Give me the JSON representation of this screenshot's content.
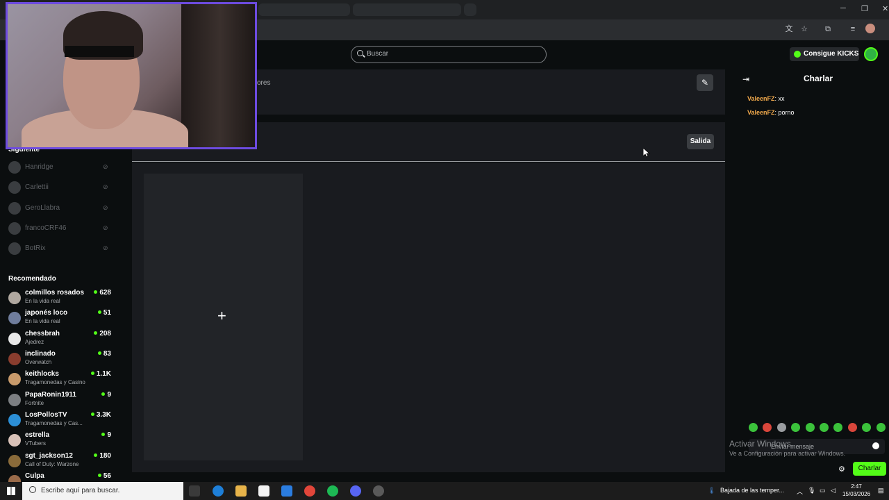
{
  "header": {
    "search_placeholder": "Buscar",
    "kicks_button": "Consigue KICKS"
  },
  "sidebar": {
    "following_heading": "Siguiente",
    "following": [
      {
        "name": "Hanridge"
      },
      {
        "name": "Carlettii"
      },
      {
        "name": "GeroLlabra"
      },
      {
        "name": "francoCRF46"
      },
      {
        "name": "BotRix"
      }
    ],
    "recommended_heading": "Recomendado",
    "recommended": [
      {
        "name": "colmillos rosados",
        "category": "En la vida real",
        "viewers": "628",
        "color": "#b0a8a0"
      },
      {
        "name": "japonés loco",
        "category": "En la vida real",
        "viewers": "51",
        "color": "#6f7d9c"
      },
      {
        "name": "chessbrah",
        "category": "Ajedrez",
        "viewers": "208",
        "color": "#e8e8e8"
      },
      {
        "name": "inclinado",
        "category": "Overwatch",
        "viewers": "83",
        "color": "#8a3d2e"
      },
      {
        "name": "keithlocks",
        "category": "Tragamonedas y Casino",
        "viewers": "1.1K",
        "color": "#c89a6b"
      },
      {
        "name": "PapaRonin1911",
        "category": "Fortnite",
        "viewers": "9",
        "color": "#7c7f82"
      },
      {
        "name": "LosPollosTV",
        "category": "Tragamonedas y Cas...",
        "viewers": "3.3K",
        "color": "#2c8fd6"
      },
      {
        "name": "estrella",
        "category": "VTubers",
        "viewers": "9",
        "color": "#d9c2b8"
      },
      {
        "name": "sgt_jackson12",
        "category": "Call of Duty: Warzone",
        "viewers": "180",
        "color": "#8a6b3a"
      },
      {
        "name": "Culpa",
        "category": "",
        "viewers": "56",
        "color": "#9a6b4a"
      }
    ]
  },
  "main": {
    "panel_partial_text": "ores",
    "edit_icon": "pencil-icon",
    "exit_button": "Salida"
  },
  "chat": {
    "title": "Charlar",
    "messages": [
      {
        "user": "ValeenFZ",
        "text": "xx"
      },
      {
        "user": "ValeenFZ",
        "text": "porno"
      }
    ],
    "input_placeholder": "Enviar mensaje",
    "send_button": "Charlar",
    "activation_title": "Activar Windows",
    "activation_subtitle": "Ve a Configuración para activar Windows."
  },
  "taskbar": {
    "search_placeholder": "Escribe aquí para buscar.",
    "weather": "Bajada de las temper...",
    "time": "2:47",
    "date": "15/03/2026"
  },
  "colors": {
    "accent": "#53fc18",
    "webcam_border": "#6d4bdf",
    "chat_username": "#f0a84b"
  }
}
